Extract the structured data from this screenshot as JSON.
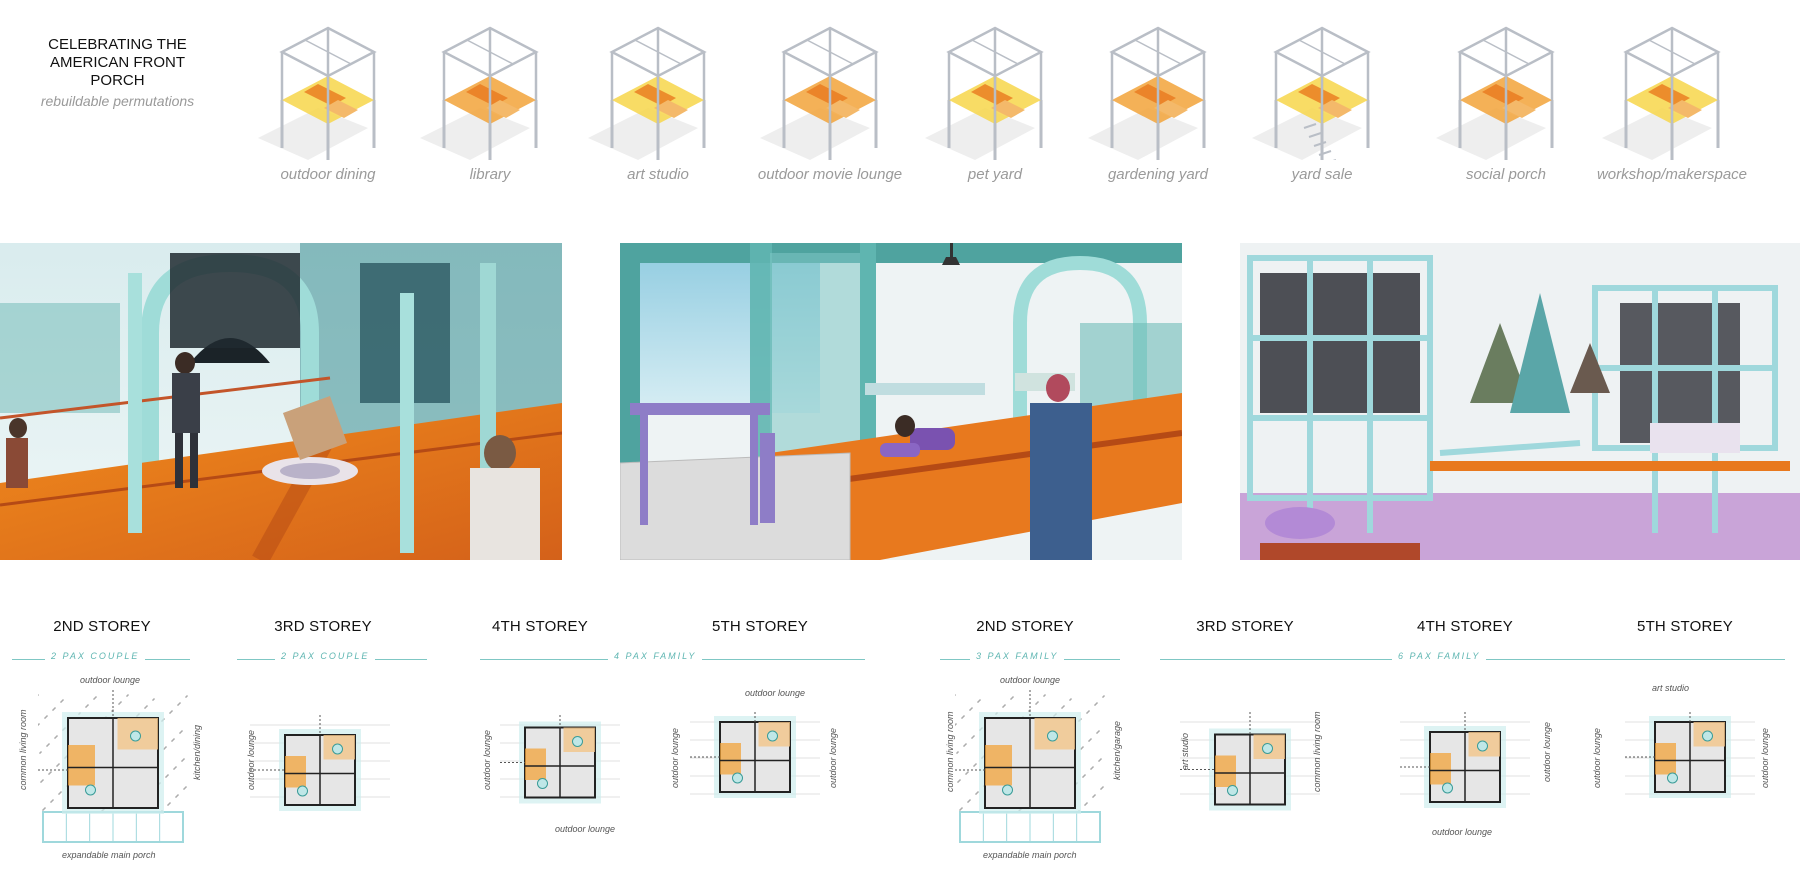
{
  "title": {
    "main": "CELEBRATING THE AMERICAN FRONT PORCH",
    "sub": "rebuildable permutations"
  },
  "permutations": [
    {
      "label": "outdoor dining",
      "stairs": false
    },
    {
      "label": "library",
      "stairs": false
    },
    {
      "label": "art studio",
      "stairs": false
    },
    {
      "label": "outdoor movie lounge",
      "stairs": false
    },
    {
      "label": "pet yard",
      "stairs": false
    },
    {
      "label": "gardening yard",
      "stairs": false
    },
    {
      "label": "yard sale",
      "stairs": true
    },
    {
      "label": "social porch",
      "stairs": false
    },
    {
      "label": "workshop/makerspace",
      "stairs": false
    }
  ],
  "renders": [
    {
      "scene": "porch-corridor-perspective"
    },
    {
      "scene": "interior-lounge-perspective"
    },
    {
      "scene": "exterior-stacked-frames-perspective"
    }
  ],
  "storeys": [
    "2ND STOREY",
    "3RD STOREY",
    "4TH STOREY",
    "5TH STOREY",
    "2ND STOREY",
    "3RD STOREY",
    "4TH STOREY",
    "5TH STOREY"
  ],
  "families": [
    "2 PAX COUPLE",
    "2 PAX COUPLE",
    "4 PAX FAMILY",
    "3 PAX FAMILY",
    "6 PAX FAMILY"
  ],
  "plan_notes": {
    "p1_top": "outdoor lounge",
    "p1_left": "common living room",
    "p1_right": "kitchen/dining",
    "p1_bottom": "expandable main porch",
    "p2_left": "outdoor lounge",
    "p3_left": "outdoor lounge",
    "p3_bottom": "outdoor lounge",
    "p4_top": "outdoor lounge",
    "p4_left": "outdoor lounge",
    "p4_right": "outdoor lounge",
    "p5_top": "outdoor lounge",
    "p5_left": "common living room",
    "p5_right": "kitchen/garage",
    "p5_bottom": "expandable main porch",
    "p6_left": "art studio",
    "p6_right": "common living room",
    "p7_right": "outdoor lounge",
    "p7_bottom": "outdoor lounge",
    "p8_top": "art studio",
    "p8_left": "outdoor lounge",
    "p8_right": "outdoor lounge"
  },
  "colors": {
    "accent_teal": "#7fc7c4",
    "frame_grey": "#b9bec6",
    "room_orange": "#f2a33a",
    "room_yellow": "#f7d64a",
    "deck_orange": "#e8791e"
  }
}
